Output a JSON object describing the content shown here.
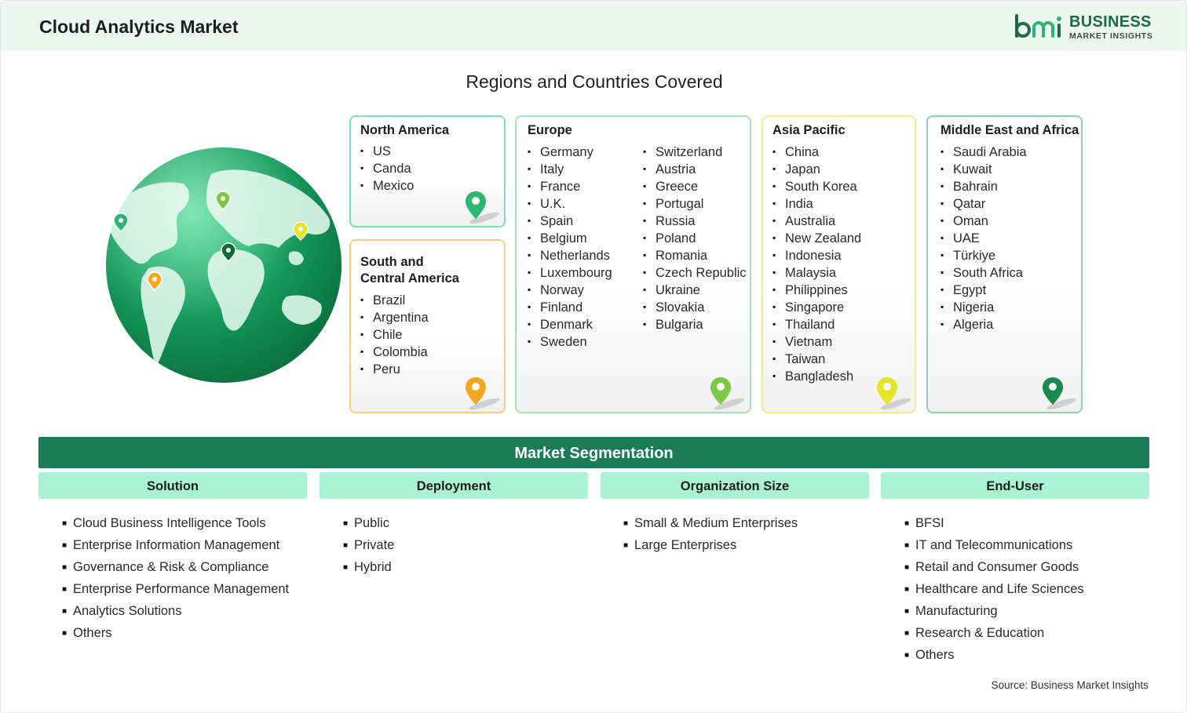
{
  "header": {
    "title": "Cloud Analytics Market",
    "logo": {
      "name": "BUSINESS",
      "tagline": "MARKET INSIGHTS",
      "mark": "bmi"
    }
  },
  "regions": {
    "title": "Regions and Countries Covered",
    "north_america": {
      "title": "North America",
      "countries": [
        "US",
        "Canda",
        "Mexico"
      ],
      "pin_color": "#2bb673"
    },
    "south_central_america": {
      "title_line1": "South and",
      "title_line2": "Central America",
      "countries": [
        "Brazil",
        "Argentina",
        "Chile",
        "Colombia",
        "Peru"
      ],
      "pin_color": "#f5a623"
    },
    "europe": {
      "title": "Europe",
      "countries_col1": [
        "Germany",
        "Italy",
        "France",
        "U.K.",
        "Spain",
        "Belgium",
        "Netherlands",
        "Luxembourg",
        "Norway",
        "Finland",
        "Denmark",
        "Sweden"
      ],
      "countries_col2": [
        "Switzerland",
        "Austria",
        "Greece",
        "Portugal",
        "Russia",
        "Poland",
        "Romania",
        "Czech Republic",
        "Ukraine",
        "Slovakia",
        "Bulgaria"
      ],
      "pin_color": "#7bc943"
    },
    "asia_pacific": {
      "title": "Asia Pacific",
      "countries": [
        "China",
        "Japan",
        "South Korea",
        "India",
        "Australia",
        "New Zealand",
        "Indonesia",
        "Malaysia",
        "Philippines",
        "Singapore",
        "Thailand",
        "Vietnam",
        "Taiwan",
        "Bangladesh"
      ],
      "pin_color": "#e5e527"
    },
    "mea": {
      "title": "Middle East and Africa",
      "countries": [
        "Saudi Arabia",
        "Kuwait",
        "Bahrain",
        "Qatar",
        "Oman",
        "UAE",
        "Türkiye",
        "South Africa",
        "Egypt",
        "Nigeria",
        "Algeria"
      ],
      "pin_color": "#1a8a4a"
    }
  },
  "segmentation": {
    "title": "Market Segmentation",
    "columns": [
      {
        "heading": "Solution",
        "items": [
          "Cloud Business Intelligence Tools",
          "Enterprise Information Management",
          "Governance & Risk & Compliance",
          "Enterprise Performance Management",
          "Analytics Solutions",
          "Others"
        ]
      },
      {
        "heading": "Deployment",
        "items": [
          "Public",
          "Private",
          "Hybrid"
        ]
      },
      {
        "heading": "Organization Size",
        "items": [
          "Small & Medium Enterprises",
          "Large Enterprises"
        ]
      },
      {
        "heading": "End-User",
        "items": [
          "BFSI",
          "IT and Telecommunications",
          "Retail and Consumer Goods",
          "Healthcare and Life Sciences",
          "Manufacturing",
          "Research & Education",
          "Others"
        ]
      }
    ]
  },
  "source": "Source: Business Market Insights",
  "colors": {
    "brand_green": "#1b7a57",
    "header_bg": "#ecf8f1",
    "segment_head_bg": "#a9f3d4"
  }
}
